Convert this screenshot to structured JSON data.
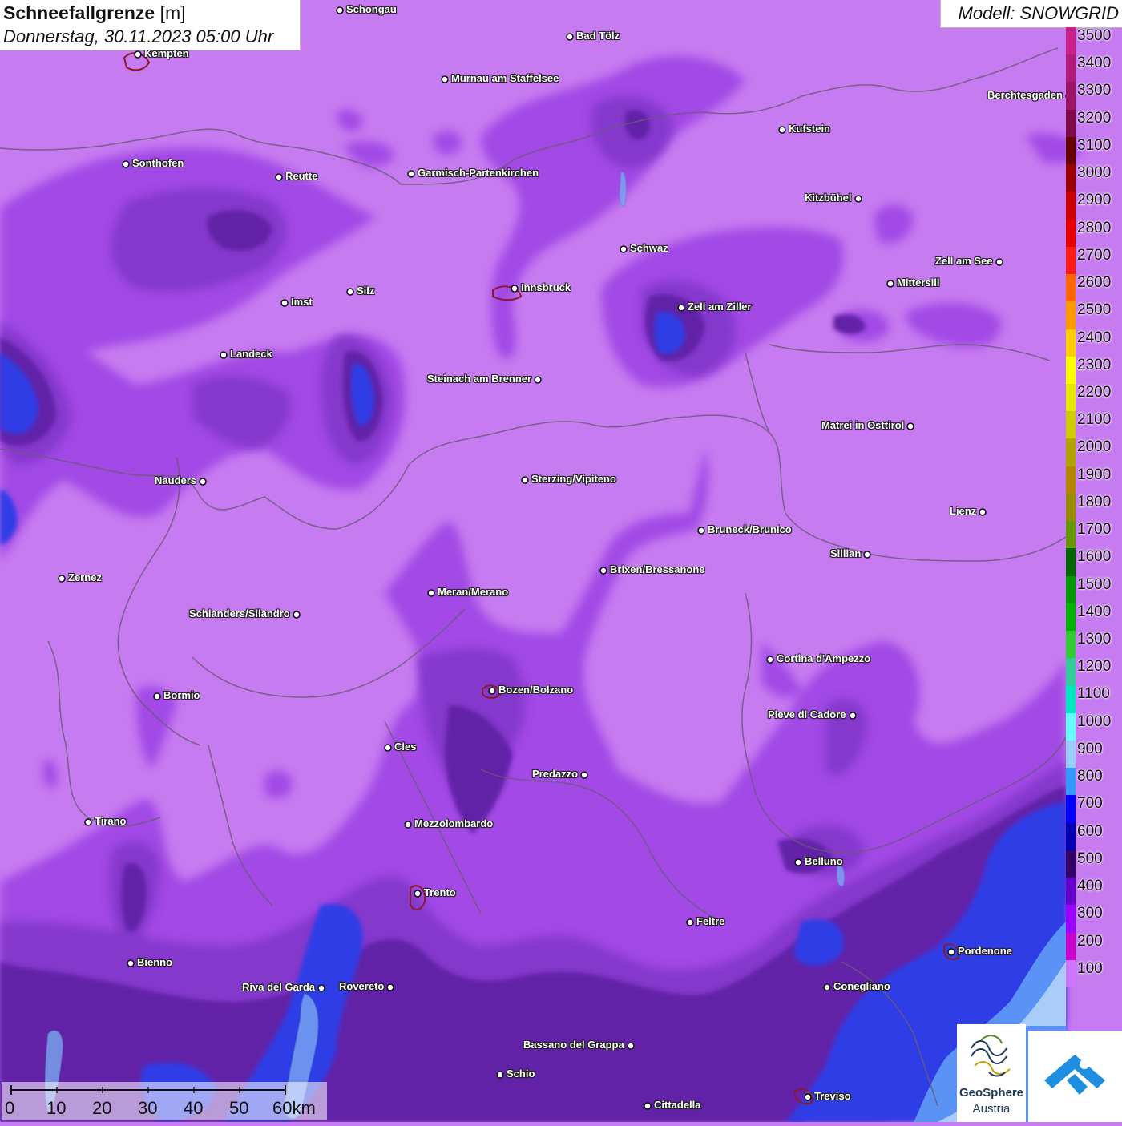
{
  "header": {
    "title": "Schneefallgrenze",
    "unit": "[m]",
    "datetime": "Donnerstag, 30.11.2023 05:00 Uhr",
    "model": "Modell: SNOWGRID"
  },
  "legend": {
    "levels": [
      {
        "value": "3500",
        "color": "#cc1f8a"
      },
      {
        "value": "3400",
        "color": "#b3197a"
      },
      {
        "value": "3300",
        "color": "#9c1468"
      },
      {
        "value": "3200",
        "color": "#7d0b47"
      },
      {
        "value": "3100",
        "color": "#660000"
      },
      {
        "value": "3000",
        "color": "#9b0000"
      },
      {
        "value": "2900",
        "color": "#cc0000"
      },
      {
        "value": "2800",
        "color": "#e60000"
      },
      {
        "value": "2700",
        "color": "#ff1a1a"
      },
      {
        "value": "2600",
        "color": "#ff6600"
      },
      {
        "value": "2500",
        "color": "#ff9900"
      },
      {
        "value": "2400",
        "color": "#ffcc00"
      },
      {
        "value": "2300",
        "color": "#ffff00"
      },
      {
        "value": "2200",
        "color": "#e6e600"
      },
      {
        "value": "2100",
        "color": "#cccc00"
      },
      {
        "value": "2000",
        "color": "#b3a300"
      },
      {
        "value": "1900",
        "color": "#b38600"
      },
      {
        "value": "1800",
        "color": "#998c00"
      },
      {
        "value": "1700",
        "color": "#669900"
      },
      {
        "value": "1600",
        "color": "#006600"
      },
      {
        "value": "1500",
        "color": "#009900"
      },
      {
        "value": "1400",
        "color": "#00b300"
      },
      {
        "value": "1300",
        "color": "#33cc33"
      },
      {
        "value": "1200",
        "color": "#33cc99"
      },
      {
        "value": "1100",
        "color": "#00e6c0"
      },
      {
        "value": "1000",
        "color": "#66ffff"
      },
      {
        "value": "900",
        "color": "#99ccff"
      },
      {
        "value": "800",
        "color": "#3399ff"
      },
      {
        "value": "700",
        "color": "#0000ff"
      },
      {
        "value": "600",
        "color": "#0000b3"
      },
      {
        "value": "500",
        "color": "#330066"
      },
      {
        "value": "400",
        "color": "#6600cc"
      },
      {
        "value": "300",
        "color": "#9900ff"
      },
      {
        "value": "200",
        "color": "#cc00cc"
      },
      {
        "value": "100",
        "color": "#cc77ff"
      }
    ]
  },
  "cities": [
    "Schongau",
    "Bad Tölz",
    "Kempten",
    "Murnau am Staffelsee",
    "Berchtesgaden",
    "Kufstein",
    "Sonthofen",
    "Reutte",
    "Garmisch-Partenkirchen",
    "Kitzbühel",
    "Schwaz",
    "Zell am See",
    "Mittersill",
    "Imst",
    "Silz",
    "Innsbruck",
    "Zell am Ziller",
    "Landeck",
    "Steinach am Brenner",
    "Matrei in Osttirol",
    "Nauders",
    "Sterzing/Vipiteno",
    "Lienz",
    "Bruneck/Brunico",
    "Sillian",
    "Zernez",
    "Brixen/Bressanone",
    "Meran/Merano",
    "Schlanders/Silandro",
    "Cortina d'Ampezzo",
    "Bozen/Bolzano",
    "Pieve di Cadore",
    "Bormio",
    "Cles",
    "Predazzo",
    "Tirano",
    "Mezzolombardo",
    "Belluno",
    "Trento",
    "Feltre",
    "Pordenone",
    "Bienno",
    "Riva del Garda",
    "Rovereto",
    "Conegliano",
    "Bassano del Grappa",
    "Schio",
    "Treviso",
    "Cittadella"
  ],
  "scale": {
    "labels": [
      "0",
      "10",
      "20",
      "30",
      "40",
      "50",
      "60km"
    ]
  },
  "logos": {
    "geosphere_line1": "GeoSphere",
    "geosphere_line2": "Austria"
  },
  "colors": {
    "base_band": "#c77bf0",
    "band_300": "#9a3be0",
    "band_400": "#7a2cc0",
    "band_500": "#5a1fa0",
    "band_600": "#3525b8",
    "band_700": "#2a3ef0",
    "band_800": "#4f8df5",
    "band_900": "#a9ccfa"
  }
}
